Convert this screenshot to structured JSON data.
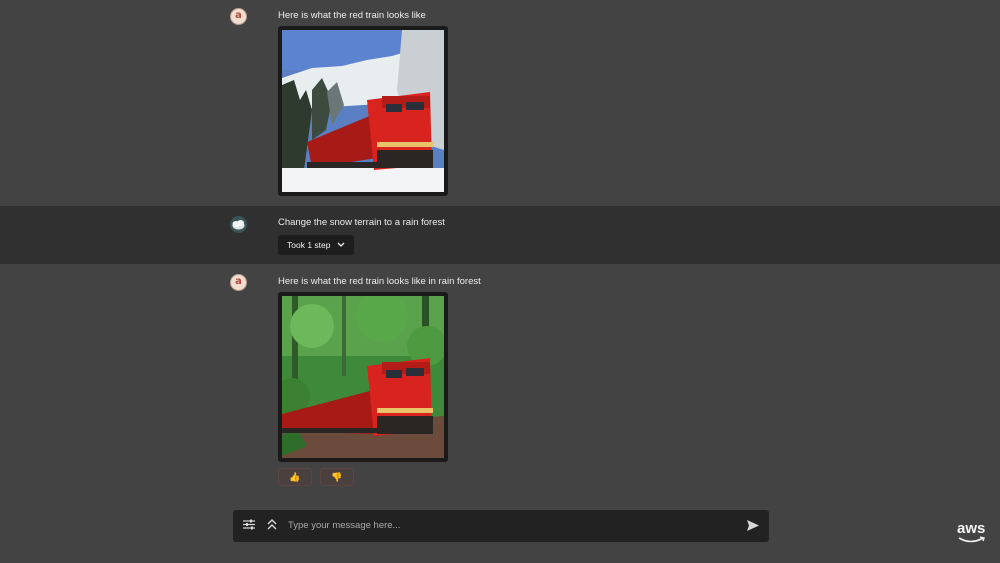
{
  "messages": [
    {
      "role": "assistant",
      "avatar_icon": "amazon-avatar-icon",
      "text": "Here is what the red train looks like",
      "image_desc": "snow"
    },
    {
      "role": "user",
      "avatar_icon": "user-avatar-icon",
      "text": "Change the snow terrain to a rain forest",
      "steps_label": "Took 1 step"
    },
    {
      "role": "assistant",
      "avatar_icon": "amazon-avatar-icon",
      "text": "Here is what the red train looks like in rain forest",
      "image_desc": "rainforest"
    }
  ],
  "feedback": {
    "thumbs_up": "👍",
    "thumbs_down": "👎"
  },
  "composer": {
    "placeholder": "Type your message here..."
  },
  "branding": {
    "logo_text": "aws"
  },
  "colors": {
    "background": "#434343",
    "user_row": "#303030",
    "train_red": "#d8231e",
    "composer_bg": "#222222"
  }
}
